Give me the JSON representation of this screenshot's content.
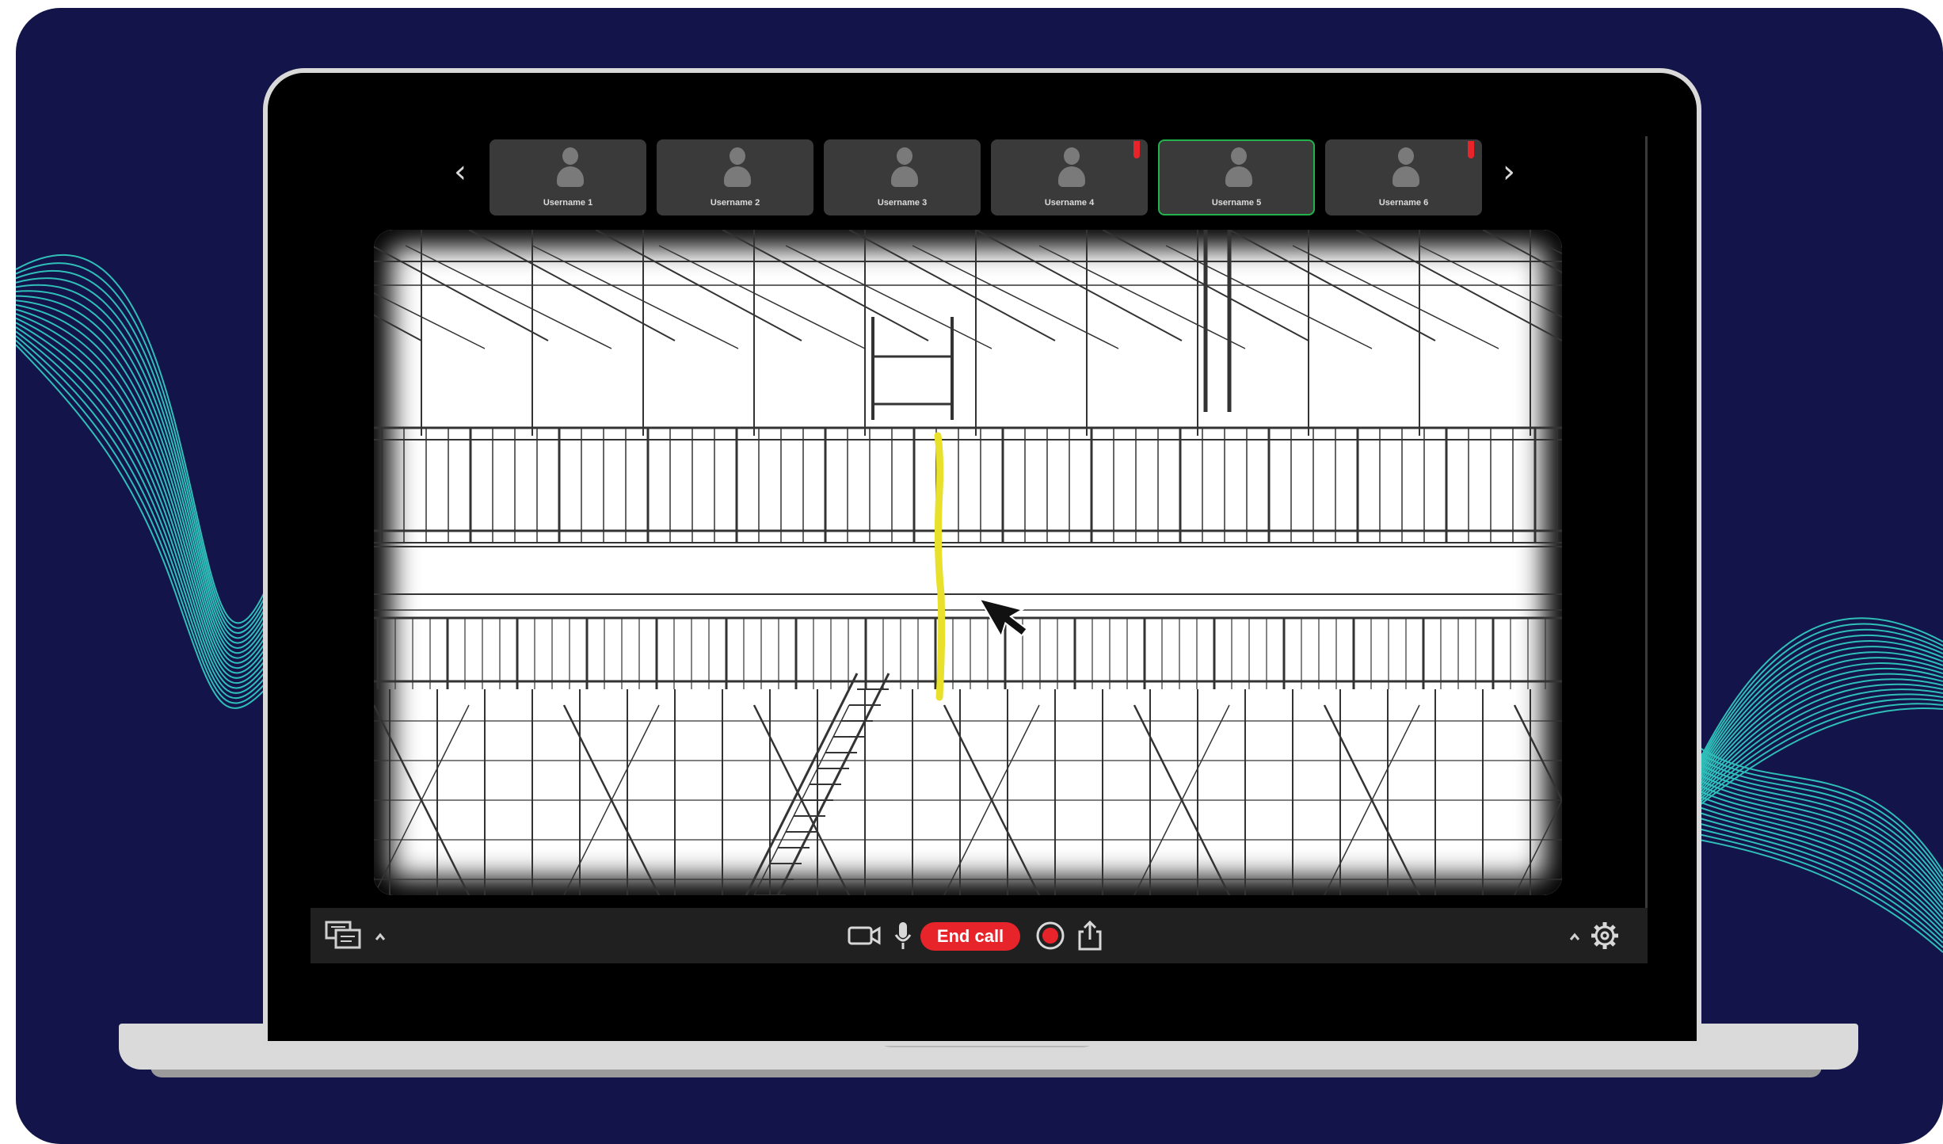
{
  "colors": {
    "background": "#13144a",
    "wave": "#33d1c4",
    "end_call": "#e8242b",
    "active_speaker": "#22b24c",
    "annotation": "#e8e02a"
  },
  "participants": [
    {
      "name": "Username 1",
      "muted": false,
      "active": false
    },
    {
      "name": "Username 2",
      "muted": false,
      "active": false
    },
    {
      "name": "Username 3",
      "muted": false,
      "active": false
    },
    {
      "name": "Username 4",
      "muted": true,
      "active": false
    },
    {
      "name": "Username 5",
      "muted": false,
      "active": true
    },
    {
      "name": "Username 6",
      "muted": true,
      "active": false
    }
  ],
  "nav": {
    "prev_icon": "chevron-left-icon",
    "next_icon": "chevron-right-icon"
  },
  "toolbar": {
    "end_call_label": "End call",
    "icons": [
      "chat-layout-icon",
      "chevron-up-icon",
      "camera-icon",
      "microphone-icon",
      "record-icon",
      "share-icon",
      "chevron-up-icon",
      "gear-icon"
    ]
  },
  "shared_content": {
    "description_icon": "steel-structure-drawing",
    "cursor_icon": "mouse-pointer-icon"
  }
}
